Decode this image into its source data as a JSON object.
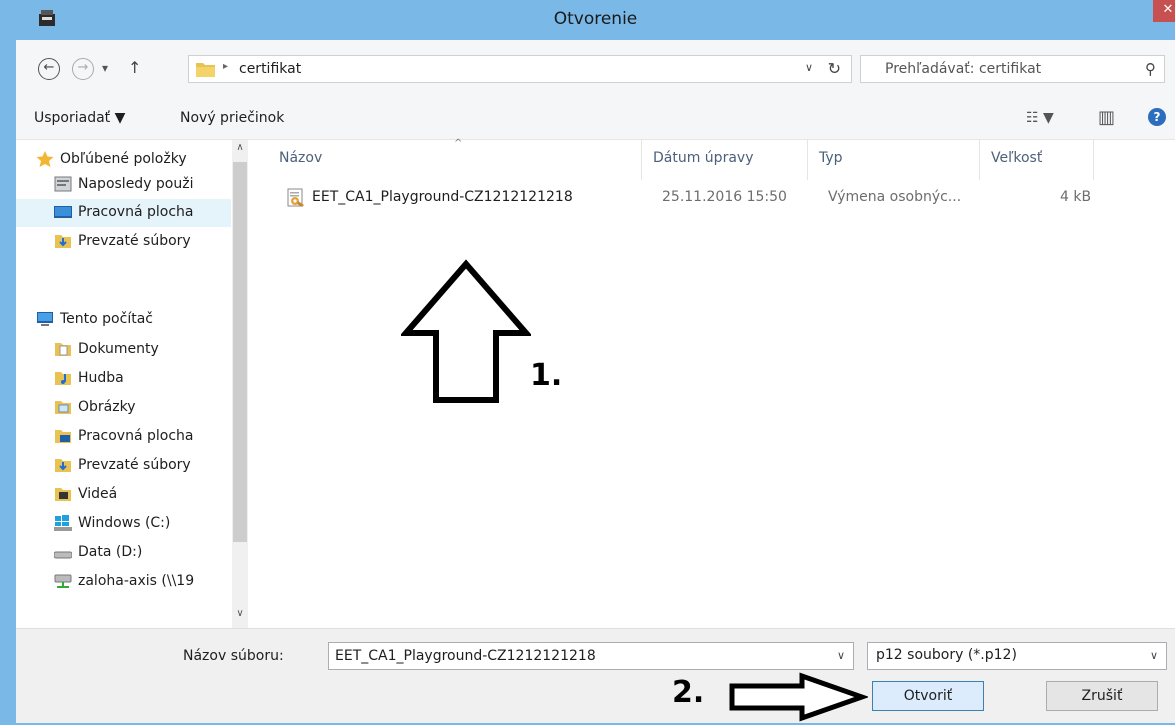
{
  "window": {
    "title": "Otvorenie",
    "close_glyph": "✕"
  },
  "nav": {
    "back_glyph": "←",
    "forward_glyph": "→",
    "recent_glyph": "▾",
    "up_glyph": "↑",
    "breadcrumb_sep": "▸",
    "breadcrumb": "certifikat",
    "address_dd_glyph": "∨",
    "refresh_glyph": "↻",
    "search_placeholder": "Prehľadávať: certifikat",
    "search_glyph": "⚲"
  },
  "toolbar": {
    "organize_label": "Usporiadať ▼",
    "new_folder_label": "Nový priečinok",
    "view_glyph": "☷ ▼",
    "pane_glyph": "▥",
    "help_glyph": "?"
  },
  "sidebar": {
    "scroll_up": "∧",
    "scroll_down": "∨",
    "items": [
      {
        "label": "Obľúbené položky",
        "icon": "star-icon"
      },
      {
        "label": "Naposledy použi",
        "icon": "recent-places-icon"
      },
      {
        "label": "Pracovná plocha",
        "icon": "desktop-icon"
      },
      {
        "label": "Prevzaté súbory",
        "icon": "downloads-folder-icon"
      },
      {
        "label": "Tento počítač",
        "icon": "computer-icon"
      },
      {
        "label": "Dokumenty",
        "icon": "documents-folder-icon"
      },
      {
        "label": "Hudba",
        "icon": "music-folder-icon"
      },
      {
        "label": "Obrázky",
        "icon": "pictures-folder-icon"
      },
      {
        "label": "Pracovná plocha",
        "icon": "desktop-folder-icon"
      },
      {
        "label": "Prevzaté súbory",
        "icon": "downloads-folder-icon"
      },
      {
        "label": "Videá",
        "icon": "videos-folder-icon"
      },
      {
        "label": "Windows (C:)",
        "icon": "windows-drive-icon"
      },
      {
        "label": "Data (D:)",
        "icon": "drive-icon"
      },
      {
        "label": "zaloha-axis (\\\\19",
        "icon": "network-drive-icon"
      }
    ]
  },
  "columns": {
    "name": "Názov",
    "date": "Dátum úpravy",
    "type": "Typ",
    "size": "Veľkosť",
    "sort_glyph": "^"
  },
  "files": [
    {
      "name": "EET_CA1_Playground-CZ1212121218",
      "date": "25.11.2016 15:50",
      "type": "Výmena osobnýc...",
      "size": "4 kB"
    }
  ],
  "bottom": {
    "filename_label": "Názov súboru:",
    "filename_value": "EET_CA1_Playground-CZ1212121218",
    "filter_value": "p12 soubory (*.p12)",
    "dd_glyph": "∨",
    "open_label": "Otvoriť",
    "cancel_label": "Zrušiť"
  },
  "annotations": {
    "step1": "1.",
    "step2": "2."
  },
  "colors": {
    "titlebar": "#7ab8e8",
    "close": "#c75050",
    "selection": "#e5f3fb"
  }
}
